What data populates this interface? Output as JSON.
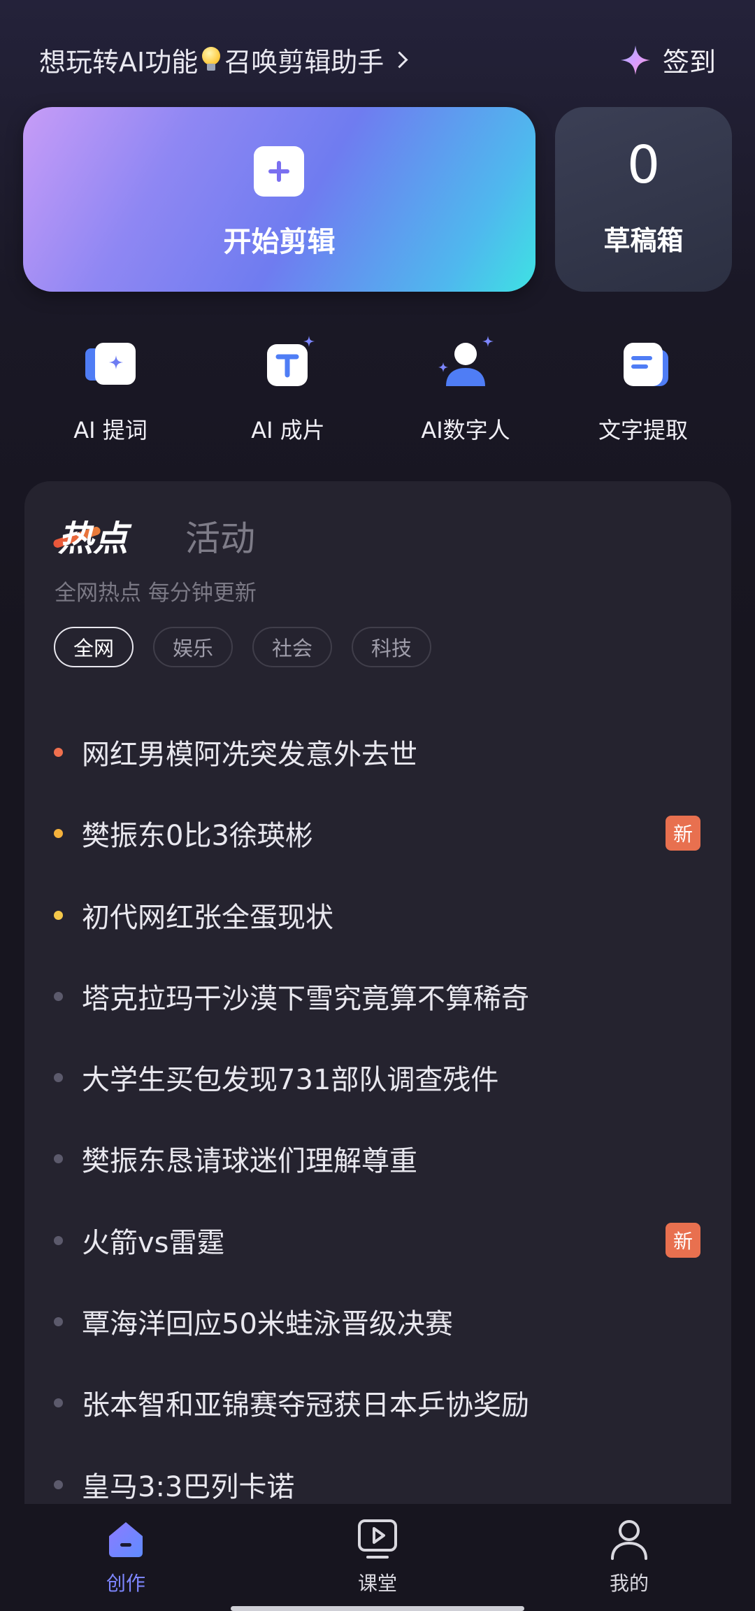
{
  "header": {
    "prompt_before": "想玩转AI功能",
    "prompt_after": "召唤剪辑助手",
    "checkin_label": "签到"
  },
  "actions": {
    "start_edit_label": "开始剪辑",
    "draft_count": "0",
    "draft_label": "草稿箱"
  },
  "tools": [
    {
      "label": "AI 提词",
      "icon": "ai-prompter-icon"
    },
    {
      "label": "AI 成片",
      "icon": "ai-film-icon"
    },
    {
      "label": "AI数字人",
      "icon": "digital-human-icon"
    },
    {
      "label": "文字提取",
      "icon": "text-extract-icon"
    }
  ],
  "hot": {
    "tab_hot": "热点",
    "tab_activity": "活动",
    "subtitle": "全网热点 每分钟更新",
    "chips": [
      "全网",
      "娱乐",
      "社会",
      "科技"
    ],
    "active_chip": "全网",
    "items": [
      {
        "text": "网红男模阿冼突发意外去世",
        "dot_color": "#f0704e",
        "badge": ""
      },
      {
        "text": "樊振东0比3徐瑛彬",
        "dot_color": "#f5b23c",
        "badge": "新"
      },
      {
        "text": "初代网红张全蛋现状",
        "dot_color": "#f5c84a",
        "badge": ""
      },
      {
        "text": "塔克拉玛干沙漠下雪究竟算不算稀奇",
        "dot_color": "#5c5a6c",
        "badge": ""
      },
      {
        "text": "大学生买包发现731部队调查残件",
        "dot_color": "#5c5a6c",
        "badge": ""
      },
      {
        "text": "樊振东恳请球迷们理解尊重",
        "dot_color": "#5c5a6c",
        "badge": ""
      },
      {
        "text": "火箭vs雷霆",
        "dot_color": "#5c5a6c",
        "badge": "新"
      },
      {
        "text": "覃海洋回应50米蛙泳晋级决赛",
        "dot_color": "#5c5a6c",
        "badge": ""
      },
      {
        "text": "张本智和亚锦赛夺冠获日本乒协奖励",
        "dot_color": "#5c5a6c",
        "badge": ""
      },
      {
        "text": "皇马3:3巴列卡诺",
        "dot_color": "#5c5a6c",
        "badge": ""
      }
    ]
  },
  "nav": [
    {
      "label": "创作",
      "icon": "create-icon",
      "active": true
    },
    {
      "label": "课堂",
      "icon": "classroom-icon",
      "active": false
    },
    {
      "label": "我的",
      "icon": "profile-icon",
      "active": false
    }
  ],
  "colors": {
    "accent": "#7d86ff",
    "badge": "#e8704f",
    "background": "#17151f",
    "panel": "#25232f"
  }
}
